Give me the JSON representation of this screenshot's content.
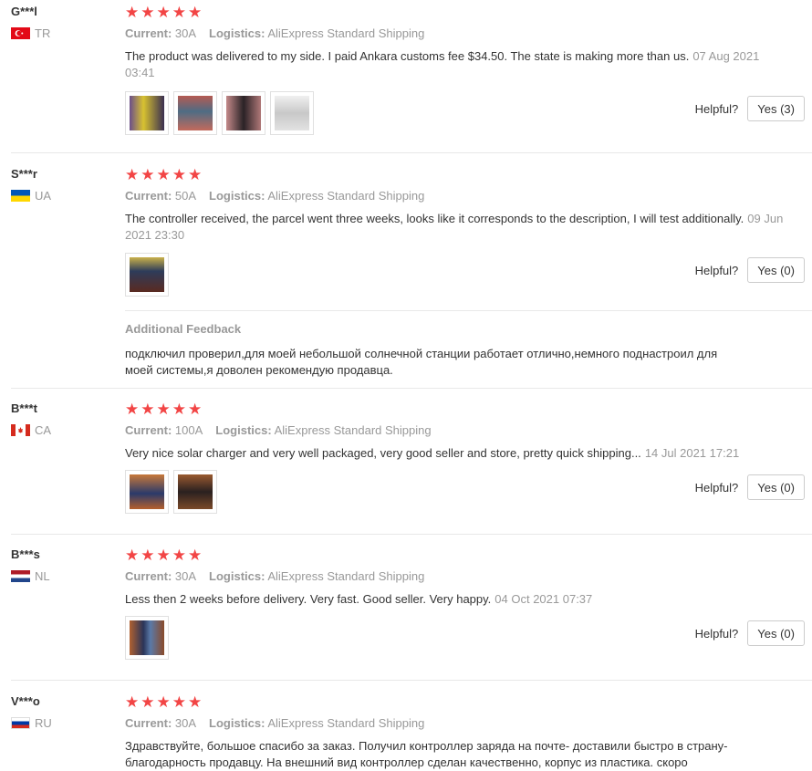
{
  "labels": {
    "current": "Current:",
    "logistics": "Logistics:",
    "helpful": "Helpful?",
    "additional": "Additional Feedback"
  },
  "reviews": [
    {
      "user": "G***l",
      "country": "TR",
      "stars": 5,
      "current": "30A",
      "logistics": "AliExpress Standard Shipping",
      "text": "The product was delivered to my side. I paid Ankara customs fee $34.50. The state is making more than us.",
      "date": "07 Aug 2021 03:41",
      "yes": "Yes (3)"
    },
    {
      "user": "S***r",
      "country": "UA",
      "stars": 5,
      "current": "50A",
      "logistics": "AliExpress Standard Shipping",
      "text": "The controller received, the parcel went three weeks, looks like it corresponds to the description, I will test additionally.",
      "date": "09 Jun 2021 23:30",
      "yes": "Yes (0)",
      "additional": "подключил проверил,для моей небольшой солнечной станции работает отлично,немного поднастроил для моей системы,я доволен рекомендую продавца."
    },
    {
      "user": "B***t",
      "country": "CA",
      "stars": 5,
      "current": "100A",
      "logistics": "AliExpress Standard Shipping",
      "text": "Very nice solar charger and very well packaged, very good seller and store, pretty quick shipping...",
      "date": "14 Jul 2021 17:21",
      "yes": "Yes (0)"
    },
    {
      "user": "B***s",
      "country": "NL",
      "stars": 5,
      "current": "30A",
      "logistics": "AliExpress Standard Shipping",
      "text": "Less then 2 weeks before delivery. Very fast. Good seller. Very happy.",
      "date": "04 Oct 2021 07:37",
      "yes": "Yes (0)"
    },
    {
      "user": "V***o",
      "country": "RU",
      "stars": 5,
      "current": "30A",
      "logistics": "AliExpress Standard Shipping",
      "text": "Здравствуйте, большое спасибо за заказ. Получил контроллер заряда на почте- доставили быстро в страну- благодарность продавцу. На внешний вид контроллер сделан качественно, корпус из пластика. скоро",
      "date": ""
    }
  ],
  "colors": {
    "star": "#f24545",
    "muted": "#999999",
    "text": "#333333"
  }
}
